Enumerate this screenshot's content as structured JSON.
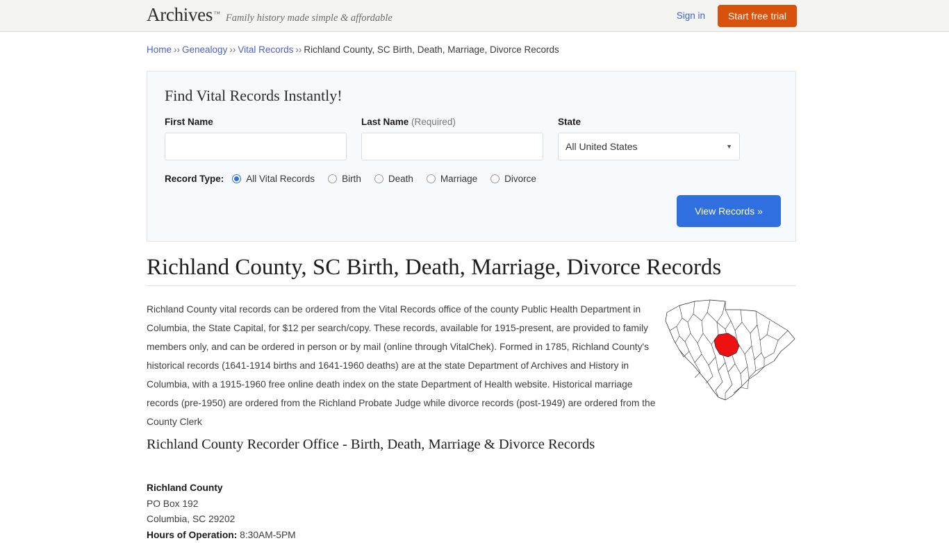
{
  "header": {
    "logo_text": "Archives",
    "logo_tm": "™",
    "tagline": "Family history made simple & affordable",
    "signin_label": "Sign in",
    "trial_label": "Start free trial",
    "accent_orange": "#d9520b",
    "link_blue": "#4060d8",
    "background": "#f4f4f0"
  },
  "breadcrumb": {
    "items": [
      {
        "label": "Home",
        "link": true
      },
      {
        "label": "Genealogy",
        "link": true
      },
      {
        "label": "Vital Records",
        "link": true
      },
      {
        "label": "Richland County, SC Birth, Death, Marriage, Divorce Records",
        "link": false
      }
    ],
    "separator": "››"
  },
  "search_panel": {
    "title": "Find Vital Records Instantly!",
    "first_name": {
      "label": "First Name",
      "value": "",
      "placeholder": ""
    },
    "last_name": {
      "label": "Last Name",
      "required_note": "(Required)",
      "value": "",
      "placeholder": ""
    },
    "state": {
      "label": "State",
      "selected": "All United States",
      "arrow_icon": "▼"
    },
    "record_type": {
      "label": "Record Type:",
      "options": [
        {
          "label": "All Vital Records",
          "selected": true
        },
        {
          "label": "Birth",
          "selected": false
        },
        {
          "label": "Death",
          "selected": false
        },
        {
          "label": "Marriage",
          "selected": false
        },
        {
          "label": "Divorce",
          "selected": false
        }
      ]
    },
    "submit_label": "View Records »",
    "submit_color": "#2f6fe0",
    "background": "#f7fafd"
  },
  "main": {
    "page_title": "Richland County, SC Birth, Death, Marriage, Divorce Records",
    "body_text": "Richland County vital records can be ordered from the Vital Records office of the county Public Health Department in Columbia, the State Capital, for $12 per search/copy. These records, available for 1915-present, are provided to family members only, and can be ordered in person or by mail (online through VitalChek). Formed in 1785, Richland County's historical records (1641-1914 births and 1641-1960 deaths) are at the state Department of Archives and History in Columbia, with a 1915-1960 free online death index on the state Department of Health website. Historical marriage records (pre-1950) are ordered from the Richland Probate Judge while divorce records (post-1949) are ordered from the County Clerk",
    "map": {
      "name": "south-carolina-county-map",
      "highlighted_county": "Richland County",
      "highlight_color": "#ee1111",
      "outline_color": "#222222"
    },
    "section_title": "Richland County Recorder Office - Birth, Death, Marriage & Divorce Records",
    "address": {
      "name": "Richland County",
      "street": "PO Box 192",
      "city_state_zip": "Columbia, SC 29202",
      "hours_label": "Hours of Operation:",
      "hours_value": "8:30AM-5PM"
    }
  }
}
